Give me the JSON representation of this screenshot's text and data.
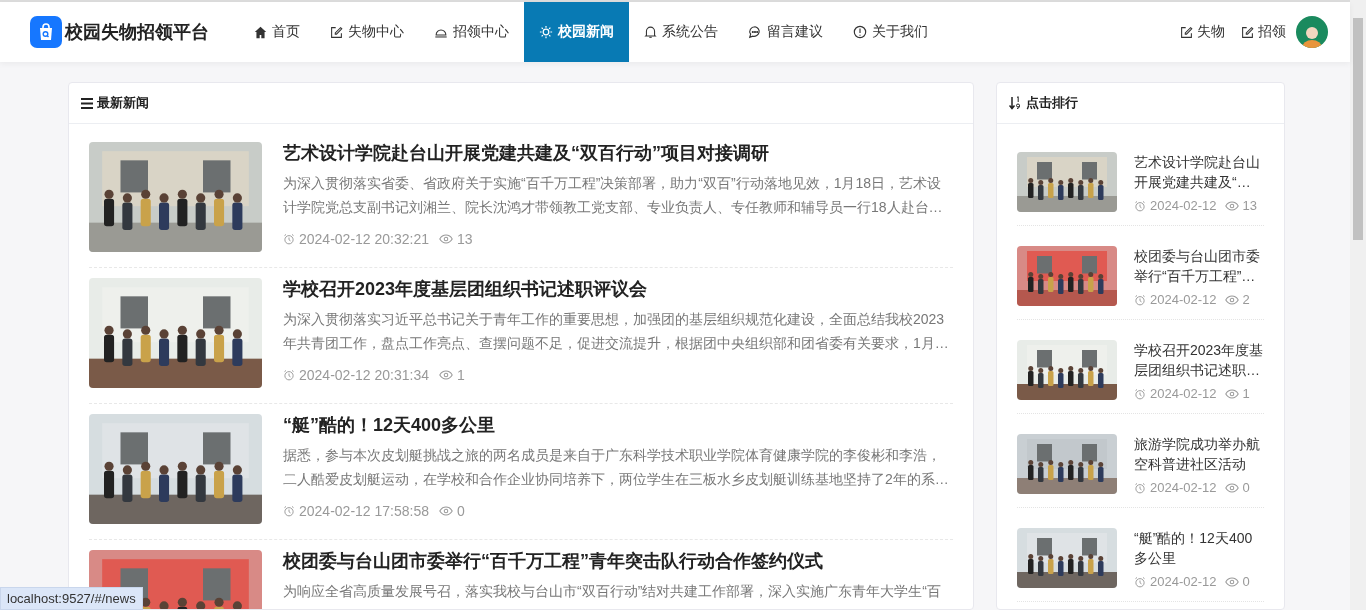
{
  "header": {
    "logo": "校园失物招领平台",
    "nav": [
      {
        "label": "首页",
        "selected": false
      },
      {
        "label": "失物中心",
        "selected": false
      },
      {
        "label": "招领中心",
        "selected": false
      },
      {
        "label": "校园新闻",
        "selected": true
      },
      {
        "label": "系统公告",
        "selected": false
      },
      {
        "label": "留言建议",
        "selected": false
      },
      {
        "label": "关于我们",
        "selected": false
      }
    ],
    "actions": [
      "失物",
      "招领"
    ]
  },
  "news": {
    "title": "最新新闻",
    "items": [
      {
        "title": "艺术设计学院赴台山开展党建共建及“双百行动”项目对接调研",
        "summary": "为深入贯彻落实省委、省政府关于实施“百千万工程”决策部署，助力“双百”行动落地见效，1月18日，艺术设计学院党总支副书记刘湘兰、院长沈鸿才带领教工党支部、专业负责人、专任教师和辅导员一行18人赴台…",
        "time": "2024-02-12 20:32:21",
        "views": "13"
      },
      {
        "title": "学校召开2023年度基层团组织书记述职评议会",
        "summary": "为深入贯彻落实习近平总书记关于青年工作的重要思想，加强团的基层组织规范化建设，全面总结我校2023年共青团工作，盘点工作亮点、查摆问题不足，促进交流提升，根据团中央组织部和团省委有关要求，1月…",
        "time": "2024-02-12 20:31:34",
        "views": "1"
      },
      {
        "title": "“艇”酷的！12天400多公里",
        "summary": "据悉，参与本次皮划艇挑战之旅的两名成员是来自于广东科学技术职业学院体育健康学院的李俊彬和李浩，二人酷爱皮划艇运动，在学校和合作企业协同培养下，两位学生在三板水乡皮划艇训练基地坚持了2年的系…",
        "time": "2024-02-12 17:58:58",
        "views": "0"
      },
      {
        "title": "校团委与台山团市委举行“百千万工程”青年突击队行动合作签约仪式",
        "summary": "为响应全省高质量发展号召，落实我校与台山市“双百行动”结对共建工作部署，深入实施广东青年大学生“百"
      }
    ]
  },
  "ranking": {
    "title": "点击排行",
    "items": [
      {
        "title": "艺术设计学院赴台山开展党建共建及“…",
        "date": "2024-02-12",
        "views": "13"
      },
      {
        "title": "校团委与台山团市委举行“百千万工程”…",
        "date": "2024-02-12",
        "views": "2"
      },
      {
        "title": "学校召开2023年度基层团组织书记述职…",
        "date": "2024-02-12",
        "views": "1"
      },
      {
        "title": "旅游学院成功举办航空科普进社区活动",
        "date": "2024-02-12",
        "views": "0"
      },
      {
        "title": "“艇”酷的！12天400多公里",
        "date": "2024-02-12",
        "views": "0"
      }
    ]
  },
  "status_url": "localhost:9527/#/news"
}
